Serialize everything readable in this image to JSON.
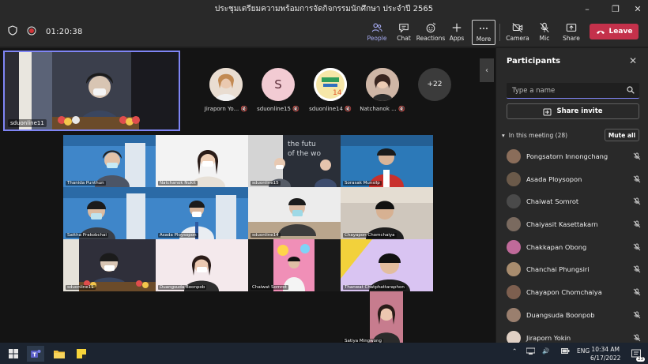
{
  "window": {
    "title": "ประชุมเตรียมความพร้อมการจัดกิจกรรมนักศึกษา ประจำปี 2565",
    "controls": [
      "minimize",
      "maximize",
      "close"
    ]
  },
  "meeting": {
    "timer": "01:20:38",
    "toolbar": [
      {
        "label": "People",
        "icon": "people-icon"
      },
      {
        "label": "Chat",
        "icon": "chat-icon"
      },
      {
        "label": "Reactions",
        "icon": "reactions-icon"
      },
      {
        "label": "Apps",
        "icon": "apps-icon"
      },
      {
        "label": "More",
        "icon": "more-icon"
      },
      {
        "label": "Camera",
        "icon": "camera-off-icon"
      },
      {
        "label": "Mic",
        "icon": "mic-off-icon"
      },
      {
        "label": "Share",
        "icon": "share-icon"
      }
    ],
    "leave_label": "Leave"
  },
  "stage": {
    "self_tile_name": "sduonline11",
    "avatars": [
      {
        "name": "Jiraporn Yo...",
        "initial": "",
        "color": "#e8d6c8"
      },
      {
        "name": "sduonline15",
        "initial": "S",
        "color": "#f2cbd3"
      },
      {
        "name": "sduonline14",
        "initial": "",
        "color": "#ffffff"
      },
      {
        "name": "Natchanok ...",
        "initial": "",
        "color": "#d9c2b5"
      }
    ],
    "overflow_count": "+22",
    "grid": [
      {
        "name": "Thanida Punthun",
        "bg": "#3f86c9"
      },
      {
        "name": "Natchanok Nukit",
        "bg": "#f3f3f3"
      },
      {
        "name": "sduonline15",
        "bg": "#dcdcdc"
      },
      {
        "name": "Sorasak Munsilp",
        "bg": "#2c79b8"
      },
      {
        "name": "Sattha Prakobchai",
        "bg": "#3f86c9"
      },
      {
        "name": "Asada Ploysopon",
        "bg": "#3f86c9"
      },
      {
        "name": "sduonline14",
        "bg": "#ececec"
      },
      {
        "name": "Chayapon Chomchaiya",
        "bg": "#cfc7bd"
      },
      {
        "name": "sduonline11",
        "bg": "#2f2f3a"
      },
      {
        "name": "Duangsuda Boonpob",
        "bg": "#f4e9ec"
      },
      {
        "name": "Chaiwat Somrot",
        "bg": "#f08fb7"
      },
      {
        "name": "Thanwat Chatphattaraphon",
        "bg": "#d9c4f2"
      },
      {
        "name": "Satiya Mingwong",
        "bg": "#c77c8e"
      }
    ]
  },
  "panel": {
    "title": "Participants",
    "search_placeholder": "Type a name",
    "share_invite": "Share invite",
    "section_label": "In this meeting (28)",
    "mute_all": "Mute all",
    "participants": [
      {
        "name": "Pongsatorn Innongchang",
        "color": "#8a6d5a"
      },
      {
        "name": "Asada Ploysopon",
        "color": "#6b5a4a"
      },
      {
        "name": "Chaiwat Somrot",
        "color": "#4a4a4a"
      },
      {
        "name": "Chaiyasit Kasettakarn",
        "color": "#7a6a5f"
      },
      {
        "name": "Chakkapan Obong",
        "color": "#c06a9a"
      },
      {
        "name": "Chanchai Phungsiri",
        "color": "#a88c6e"
      },
      {
        "name": "Chayapon Chomchaiya",
        "color": "#7d5f4f"
      },
      {
        "name": "Duangsuda Boonpob",
        "color": "#9a7f6e"
      },
      {
        "name": "Jiraporn Yokin",
        "color": "#e0d0c4"
      }
    ]
  },
  "taskbar": {
    "lang": "ENG",
    "time": "10:34 AM",
    "date": "6/17/2022",
    "badge": "23"
  }
}
